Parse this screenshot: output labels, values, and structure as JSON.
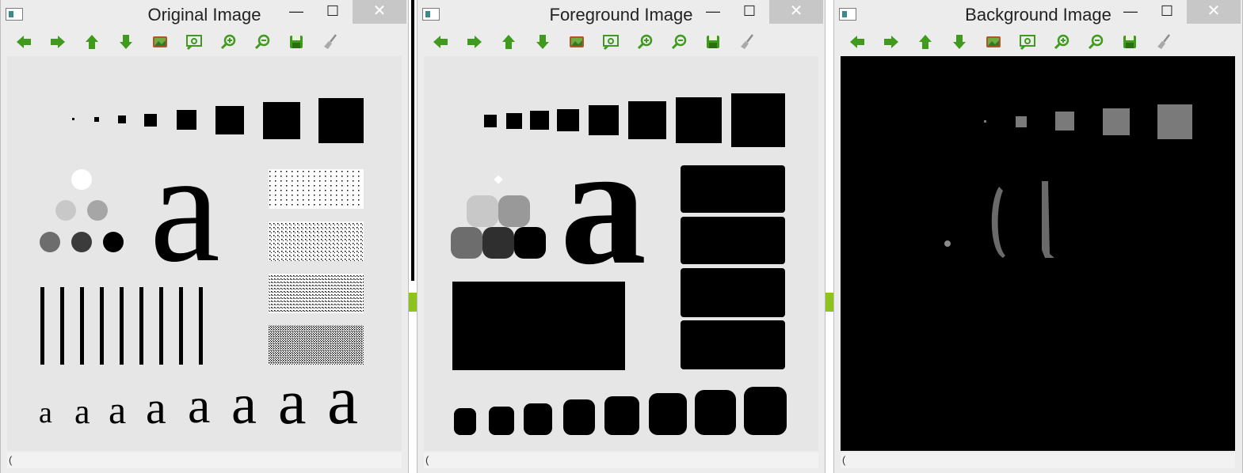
{
  "windows": {
    "original": {
      "title": "Original Image",
      "status": "("
    },
    "foreground": {
      "title": "Foreground Image",
      "status": "("
    },
    "background": {
      "title": "Background Image",
      "status": "("
    }
  },
  "controls": {
    "minimize": "—",
    "maximize": "☐",
    "close": "✕"
  },
  "toolbar_icons": [
    "arrow-left-icon",
    "arrow-right-icon",
    "arrow-up-icon",
    "arrow-down-icon",
    "image-icon",
    "zoom-fit-icon",
    "zoom-in-icon",
    "zoom-out-icon",
    "save-icon",
    "clear-brush-icon"
  ],
  "image_glyphs": {
    "big_a": "a",
    "small_a": "a"
  },
  "colors": {
    "toolbar_green": "#3f9a1e",
    "close_btn": "#c7c7c7",
    "canvas_gray": "#e6e6e6"
  }
}
